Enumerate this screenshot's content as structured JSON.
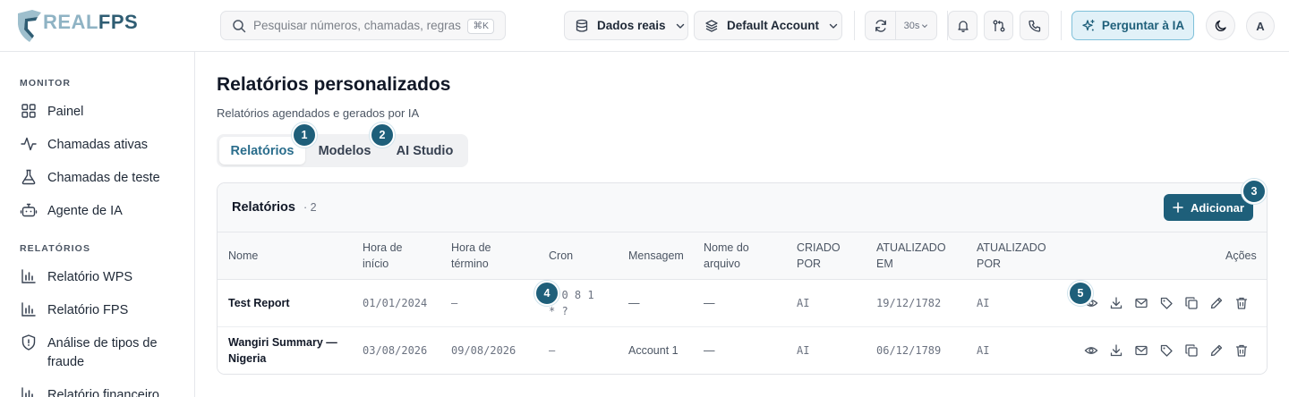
{
  "brand": {
    "logo_text_a": "REAL",
    "logo_text_b": "FPS",
    "accent": "#1e5f7a"
  },
  "header": {
    "search_placeholder": "Pesquisar números, chamadas, regras...",
    "search_shortcut": "⌘K",
    "data_mode": "Dados reais",
    "account": "Default Account",
    "refresh_interval": "30s",
    "ask_ai": "Perguntar à IA",
    "avatar_initial": "A"
  },
  "sidebar": {
    "sections": [
      {
        "title": "MONITOR",
        "items": [
          {
            "label": "Painel",
            "icon": "dashboard-icon"
          },
          {
            "label": "Chamadas ativas",
            "icon": "activity-icon"
          },
          {
            "label": "Chamadas de teste",
            "icon": "flask-icon"
          },
          {
            "label": "Agente de IA",
            "icon": "bot-icon"
          }
        ]
      },
      {
        "title": "RELATÓRIOS",
        "items": [
          {
            "label": "Relatório WPS",
            "icon": "bar-chart-icon"
          },
          {
            "label": "Relatório FPS",
            "icon": "bar-chart-icon"
          },
          {
            "label": "Análise de tipos de fraude",
            "icon": "shield-icon"
          },
          {
            "label": "Relatório financeiro",
            "icon": "bar-chart-icon"
          }
        ]
      }
    ]
  },
  "main": {
    "title": "Relatórios personalizados",
    "subtitle": "Relatórios agendados e gerados por IA",
    "tabs": [
      {
        "label": "Relatórios",
        "active": true
      },
      {
        "label": "Modelos",
        "active": false
      },
      {
        "label": "AI Studio",
        "active": false
      }
    ],
    "badges": [
      "1",
      "2",
      "3",
      "4",
      "5"
    ],
    "card": {
      "title": "Relatórios",
      "count": "· 2",
      "add_label": "Adicionar",
      "columns": [
        "Nome",
        "Hora de início",
        "Hora de término",
        "Cron",
        "Mensagem",
        "Nome do arquivo",
        "CRIADO POR",
        "ATUALIZADO EM",
        "ATUALIZADO POR",
        "Ações"
      ],
      "rows": [
        {
          "name": "Test Report",
          "start": "01/01/2024",
          "end": "—",
          "cron": "0 0 8 1 * ?",
          "message": "—",
          "filename": "—",
          "created_by": "AI",
          "updated_at": "19/12/1782",
          "updated_by": "AI"
        },
        {
          "name": "Wangiri Summary — Nigeria",
          "start": "03/08/2026",
          "end": "09/08/2026",
          "cron": "—",
          "message": "Account 1",
          "filename": "—",
          "created_by": "AI",
          "updated_at": "06/12/1789",
          "updated_by": "AI"
        }
      ],
      "row_actions": [
        "eye-icon",
        "download-icon",
        "mail-icon",
        "tag-icon",
        "copy-icon",
        "pencil-icon",
        "trash-icon"
      ]
    }
  }
}
